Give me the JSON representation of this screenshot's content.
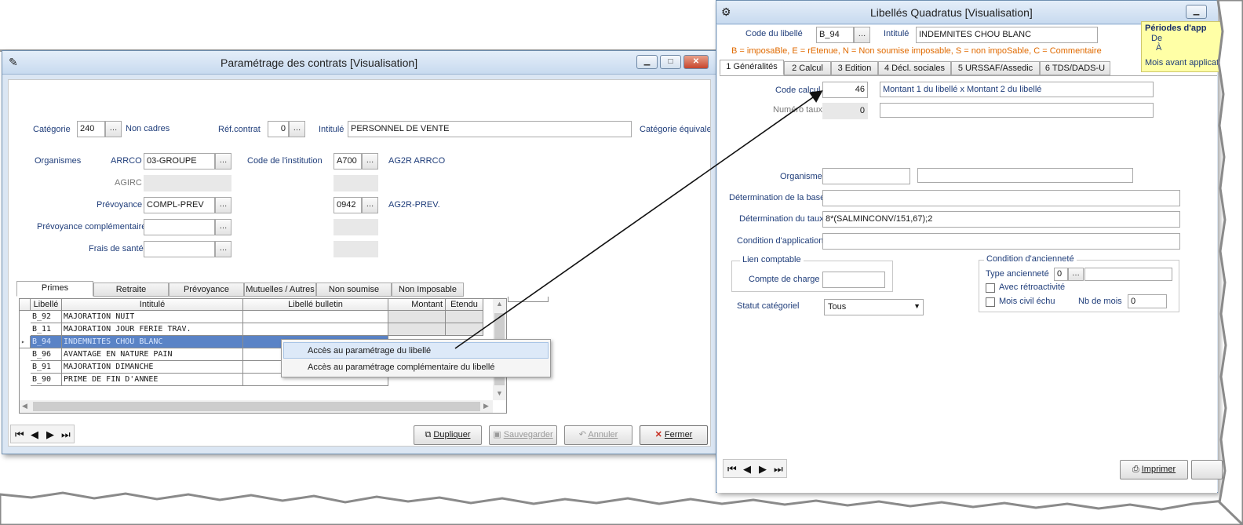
{
  "left": {
    "title": "Paramétrage des contrats   [Visualisation]",
    "categorie": {
      "label": "Catégorie",
      "value": "240",
      "desc": "Non cadres"
    },
    "refcontrat": {
      "label": "Réf.contrat",
      "value": "0"
    },
    "intitule": {
      "label": "Intitulé",
      "value": "PERSONNEL DE VENTE"
    },
    "cat_equiv": "Catégorie équivalen",
    "organismes": "Organismes",
    "arrco": {
      "label": "ARRCO",
      "value": "03-GROUPE"
    },
    "agirc": "AGIRC",
    "prevoyance": {
      "label": "Prévoyance",
      "value": "COMPL-PREV"
    },
    "prev_comp": "Prévoyance complémentaire",
    "frais": "Frais de santé",
    "code_inst": "Code de l'institution",
    "inst1": {
      "code": "A700",
      "name": "AG2R ARRCO"
    },
    "inst2": {
      "code": "0942",
      "name": "AG2R-PREV."
    },
    "tabs": [
      "Primes",
      "Retraite",
      "Prévoyance",
      "Mutuelles / Autres",
      "Non soumise",
      "Non Imposable"
    ],
    "grid_headers": [
      "Libellé",
      "Intitulé",
      "Libellé bulletin",
      "Montant",
      "Etendu"
    ],
    "rows": [
      {
        "code": "B_92",
        "label": "MAJORATION NUIT"
      },
      {
        "code": "B_11",
        "label": "MAJORATION  JOUR FERIE TRAV."
      },
      {
        "code": "B_94",
        "label": "INDEMNITES CHOU BLANC"
      },
      {
        "code": "B_96",
        "label": "AVANTAGE EN NATURE PAIN"
      },
      {
        "code": "B_91",
        "label": "MAJORATION DIMANCHE"
      },
      {
        "code": "B_90",
        "label": "PRIME DE FIN D'ANNEE"
      }
    ],
    "context_menu": [
      "Accès au paramétrage du libellé",
      "Accès au paramétrage complémentaire du libellé"
    ],
    "buttons": {
      "dupliquer": "Dupliquer",
      "sauvegarder": "Sauvegarder",
      "annuler": "Annuler",
      "fermer": "Fermer"
    }
  },
  "right": {
    "title": "Libellés Quadratus   [Visualisation]",
    "code_libelle": {
      "label": "Code du libellé",
      "value": "B_94"
    },
    "intitule": {
      "label": "Intitulé",
      "value": "INDEMNITES CHOU BLANC"
    },
    "legend": "B = imposaBle, E = rEtenue, N = Non soumise imposable, S = non impoSable, C = Commentaire",
    "tabs": [
      "1 Généralités",
      "2 Calcul",
      "3 Edition",
      "4 Décl. sociales",
      "5 URSSAF/Assedic",
      "6 TDS/DADS-U"
    ],
    "code_calcul": {
      "label": "Code calcul",
      "value": "46",
      "desc": "Montant 1 du libellé x Montant 2 du libellé"
    },
    "numero_taux": {
      "label": "Numéro taux",
      "value": "0"
    },
    "organisme": "Organisme",
    "det_base": "Détermination de la base",
    "det_taux": {
      "label": "Détermination du taux",
      "value": "8*(SALMINCONV/151,67);2"
    },
    "condition": "Condition d'application",
    "lien": "Lien comptable",
    "compte": "Compte de charge",
    "statut": {
      "label": "Statut catégoriel",
      "value": "Tous"
    },
    "anciennete": {
      "title": "Condition d'ancienneté",
      "type_label": "Type ancienneté",
      "type_value": "0",
      "retro": "Avec rétroactivité",
      "mois_civil": "Mois civil échu",
      "nb_mois_label": "Nb de mois",
      "nb_mois_value": "0"
    },
    "periodes": {
      "title": "Périodes d'app",
      "de": "De",
      "a": "À",
      "mois": "Mois avant applicat"
    },
    "imprimer": "Imprimer"
  }
}
